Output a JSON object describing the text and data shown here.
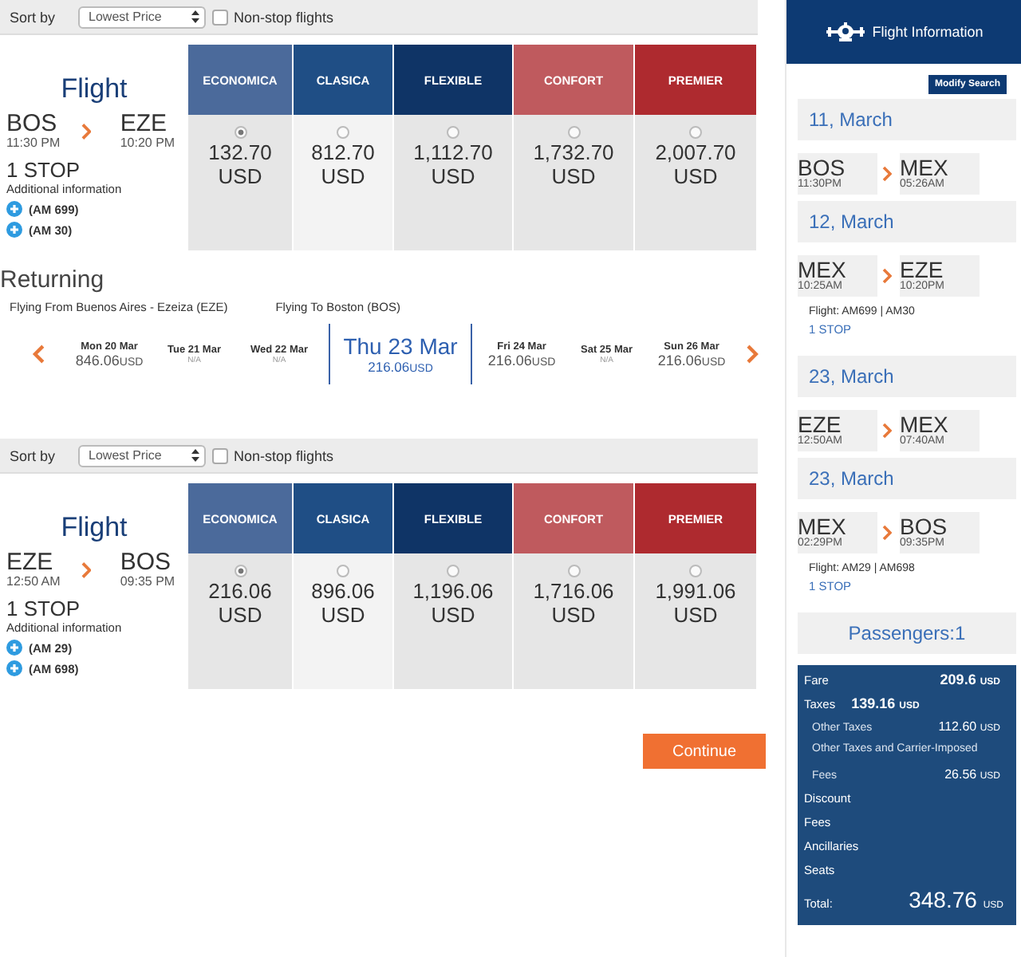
{
  "outbound": {
    "sort": {
      "label": "Sort by",
      "value": "Lowest Price",
      "nonstop_label": "Non-stop flights",
      "nonstop_checked": false
    },
    "flight": {
      "heading": "Flight",
      "from": "BOS",
      "depart": "11:30 PM",
      "to": "EZE",
      "arrive": "10:20 PM",
      "stops": "1 STOP",
      "info_label": "Additional information",
      "legs": [
        "(AM 699)",
        "(AM 30)"
      ]
    },
    "fares": [
      {
        "name": "ECONOMICA",
        "color": "#4b6a9b",
        "amount": "132.70",
        "currency": "USD",
        "selected": true
      },
      {
        "name": "CLASICA",
        "color": "#1f4e85",
        "amount": "812.70",
        "currency": "USD",
        "selected": false
      },
      {
        "name": "FLEXIBLE",
        "color": "#0f3466",
        "amount": "1,112.70",
        "currency": "USD",
        "selected": false
      },
      {
        "name": "CONFORT",
        "color": "#bf5a5e",
        "amount": "1,732.70",
        "currency": "USD",
        "selected": false
      },
      {
        "name": "PREMIER",
        "color": "#ae2a2f",
        "amount": "2,007.70",
        "currency": "USD",
        "selected": false
      }
    ]
  },
  "returning": {
    "title": "Returning",
    "from_text": "Flying From Buenos Aires - Ezeiza (EZE)",
    "to_text": "Flying To Boston (BOS)",
    "dates": [
      {
        "day": "Mon 20 Mar",
        "price": "846.06",
        "currency": "USD",
        "selected": false
      },
      {
        "day": "Tue 21 Mar",
        "price": "N/A",
        "selected": false
      },
      {
        "day": "Wed 22 Mar",
        "price": "N/A",
        "selected": false
      },
      {
        "day": "Thu 23 Mar",
        "price": "216.06",
        "currency": "USD",
        "selected": true
      },
      {
        "day": "Fri 24 Mar",
        "price": "216.06",
        "currency": "USD",
        "selected": false
      },
      {
        "day": "Sat 25 Mar",
        "price": "N/A",
        "selected": false
      },
      {
        "day": "Sun 26 Mar",
        "price": "216.06",
        "currency": "USD",
        "selected": false
      }
    ]
  },
  "inbound": {
    "sort": {
      "label": "Sort by",
      "value": "Lowest Price",
      "nonstop_label": "Non-stop flights",
      "nonstop_checked": false
    },
    "flight": {
      "heading": "Flight",
      "from": "EZE",
      "depart": "12:50 AM",
      "to": "BOS",
      "arrive": "09:35 PM",
      "stops": "1 STOP",
      "info_label": "Additional information",
      "legs": [
        "(AM 29)",
        "(AM 698)"
      ]
    },
    "fares": [
      {
        "name": "ECONOMICA",
        "color": "#4b6a9b",
        "amount": "216.06",
        "currency": "USD",
        "selected": true
      },
      {
        "name": "CLASICA",
        "color": "#1f4e85",
        "amount": "896.06",
        "currency": "USD",
        "selected": false
      },
      {
        "name": "FLEXIBLE",
        "color": "#0f3466",
        "amount": "1,196.06",
        "currency": "USD",
        "selected": false
      },
      {
        "name": "CONFORT",
        "color": "#bf5a5e",
        "amount": "1,716.06",
        "currency": "USD",
        "selected": false
      },
      {
        "name": "PREMIER",
        "color": "#ae2a2f",
        "amount": "1,991.06",
        "currency": "USD",
        "selected": false
      }
    ]
  },
  "continue": "Continue",
  "sidebar": {
    "title": "Flight Information",
    "modify": "Modify Search",
    "groups": [
      {
        "date": "11, March",
        "from": "BOS",
        "from_time": "11:30PM",
        "to": "MEX",
        "to_time": "05:26AM"
      },
      {
        "date": "12, March",
        "from": "MEX",
        "from_time": "10:25AM",
        "to": "EZE",
        "to_time": "10:20PM",
        "flight": "Flight: AM699 | AM30",
        "stops": "1 STOP"
      },
      {
        "date": "23, March",
        "from": "EZE",
        "from_time": "12:50AM",
        "to": "MEX",
        "to_time": "07:40AM"
      },
      {
        "date": "23, March",
        "from": "MEX",
        "from_time": "02:29PM",
        "to": "BOS",
        "to_time": "09:35PM",
        "flight": "Flight: AM29 | AM698",
        "stops": "1 STOP"
      }
    ],
    "passengers": "Passengers:1",
    "price": {
      "rows": [
        {
          "kind": "main",
          "label": "Fare",
          "amount": "209.6",
          "currency": "USD"
        },
        {
          "kind": "inline",
          "label": "Taxes",
          "amount": "139.16",
          "currency": "USD"
        },
        {
          "kind": "sub",
          "label": "Other Taxes",
          "amount": "112.60",
          "currency": "USD"
        },
        {
          "kind": "sub",
          "label": "Other Taxes and Carrier-Imposed"
        },
        {
          "kind": "sub",
          "label": "Fees",
          "amount": "26.56",
          "currency": "USD"
        },
        {
          "kind": "plain",
          "label": "Discount"
        },
        {
          "kind": "plain",
          "label": "Fees"
        },
        {
          "kind": "plain",
          "label": "Ancillaries"
        },
        {
          "kind": "plain",
          "label": "Seats"
        }
      ],
      "total_label": "Total:",
      "total": "348.76",
      "currency": "USD"
    }
  }
}
